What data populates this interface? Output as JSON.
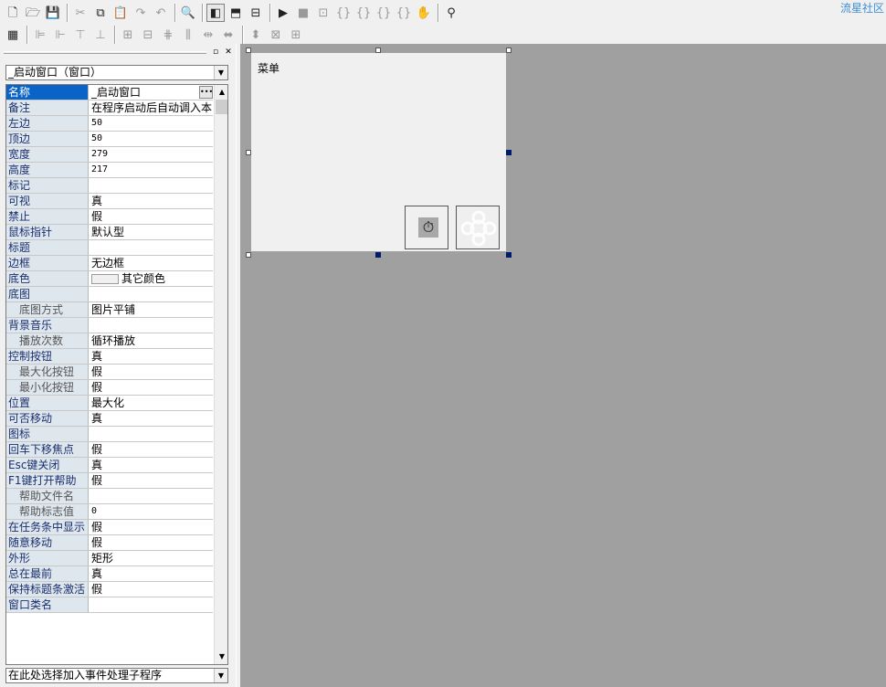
{
  "brand": "流星社区",
  "toolbar1": {
    "icons": [
      "new-file-icon",
      "open-folder-icon",
      "save-icon",
      "cut-icon",
      "copy-icon",
      "paste-icon",
      "redo-icon",
      "undo-icon",
      "find-icon",
      "layout-left-icon",
      "layout-top-icon",
      "layout-split-icon",
      "run-icon",
      "stop-icon",
      "step-icon",
      "step-into-icon",
      "step-over-icon",
      "step-out-icon",
      "run-to-cursor-icon",
      "hand-icon",
      "binoculars-icon"
    ]
  },
  "toolbar2": {
    "icons": [
      "calculator-icon",
      "align-left-icon",
      "align-right-icon",
      "align-top-icon",
      "align-bottom-icon",
      "center-horizontal-icon",
      "center-vertical-icon",
      "align-middle-icon",
      "space-horizontal-icon",
      "space-equal-icon",
      "same-width-icon",
      "same-height-icon",
      "same-size-icon"
    ]
  },
  "panel": {
    "object_combo": "_启动窗口（窗口）",
    "event_combo": "在此处选择加入事件处理子程序",
    "properties": [
      {
        "name": "名称",
        "value": "_启动窗口",
        "selected": true
      },
      {
        "name": "备注",
        "value": "在程序启动后自动调入本"
      },
      {
        "name": "左边",
        "value": "50",
        "num": true
      },
      {
        "name": "顶边",
        "value": "50",
        "num": true
      },
      {
        "name": "宽度",
        "value": "279",
        "num": true
      },
      {
        "name": "高度",
        "value": "217",
        "num": true
      },
      {
        "name": "标记",
        "value": ""
      },
      {
        "name": "可视",
        "value": "真"
      },
      {
        "name": "禁止",
        "value": "假"
      },
      {
        "name": "鼠标指针",
        "value": "默认型"
      },
      {
        "name": "标题",
        "value": ""
      },
      {
        "name": "边框",
        "value": "无边框"
      },
      {
        "name": "底色",
        "value": "其它颜色",
        "swatch": true
      },
      {
        "name": "底图",
        "value": ""
      },
      {
        "name": "底图方式",
        "value": "图片平铺",
        "sub": true
      },
      {
        "name": "背景音乐",
        "value": ""
      },
      {
        "name": "播放次数",
        "value": "循环播放",
        "sub": true
      },
      {
        "name": "控制按钮",
        "value": "真"
      },
      {
        "name": "最大化按钮",
        "value": "假",
        "sub": true
      },
      {
        "name": "最小化按钮",
        "value": "假",
        "sub": true
      },
      {
        "name": "位置",
        "value": "最大化"
      },
      {
        "name": "可否移动",
        "value": "真"
      },
      {
        "name": "图标",
        "value": ""
      },
      {
        "name": "回车下移焦点",
        "value": "假"
      },
      {
        "name": "Esc键关闭",
        "value": "真"
      },
      {
        "name": "F1键打开帮助",
        "value": "假"
      },
      {
        "name": "帮助文件名",
        "value": "",
        "sub": true
      },
      {
        "name": "帮助标志值",
        "value": "0",
        "sub": true,
        "num": true
      },
      {
        "name": "在任务条中显示",
        "value": "假"
      },
      {
        "name": "随意移动",
        "value": "假"
      },
      {
        "name": "外形",
        "value": "矩形"
      },
      {
        "name": "总在最前",
        "value": "真"
      },
      {
        "name": "保持标题条激活",
        "value": "假"
      },
      {
        "name": "窗口类名",
        "value": ""
      }
    ]
  },
  "form": {
    "menu_label": "菜单"
  }
}
